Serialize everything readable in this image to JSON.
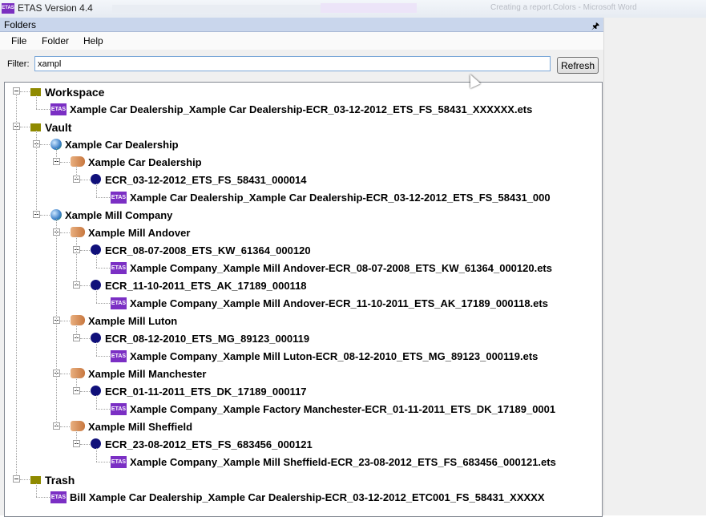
{
  "window": {
    "app_icon": "ETAS",
    "title": "ETAS Version 4.4",
    "background_text": "Creating a report.Colors - Microsoft Word"
  },
  "pane": {
    "title": "Folders",
    "pin_icon": "pin-icon"
  },
  "menu": [
    "File",
    "Folder",
    "Help"
  ],
  "filter": {
    "label": "Filter:",
    "value": "xampl",
    "refresh_label": "Refresh"
  },
  "tree": [
    {
      "level": 0,
      "icon": "folder",
      "label": "Workspace",
      "expandable": true
    },
    {
      "level": 1,
      "icon": "etas",
      "label": "Xample Car Dealership_Xample Car Dealership-ECR_03-12-2012_ETS_FS_58431_XXXXXX.ets",
      "expandable": false
    },
    {
      "level": 0,
      "icon": "folder",
      "label": "Vault",
      "expandable": true
    },
    {
      "level": 1,
      "icon": "globe",
      "label": "Xample Car Dealership",
      "expandable": true
    },
    {
      "level": 2,
      "icon": "hand",
      "label": "Xample Car Dealership",
      "expandable": true
    },
    {
      "level": 3,
      "icon": "dot",
      "label": "ECR_03-12-2012_ETS_FS_58431_000014",
      "expandable": true
    },
    {
      "level": 4,
      "icon": "etas",
      "label": "Xample Car Dealership_Xample Car Dealership-ECR_03-12-2012_ETS_FS_58431_000",
      "expandable": false
    },
    {
      "level": 1,
      "icon": "globe",
      "label": "Xample Mill Company",
      "expandable": true
    },
    {
      "level": 2,
      "icon": "hand",
      "label": "Xample Mill Andover",
      "expandable": true
    },
    {
      "level": 3,
      "icon": "dot",
      "label": "ECR_08-07-2008_ETS_KW_61364_000120",
      "expandable": true
    },
    {
      "level": 4,
      "icon": "etas",
      "label": "Xample Company_Xample Mill Andover-ECR_08-07-2008_ETS_KW_61364_000120.ets",
      "expandable": false
    },
    {
      "level": 3,
      "icon": "dot",
      "label": "ECR_11-10-2011_ETS_AK_17189_000118",
      "expandable": true
    },
    {
      "level": 4,
      "icon": "etas",
      "label": "Xample Company_Xample Mill Andover-ECR_11-10-2011_ETS_AK_17189_000118.ets",
      "expandable": false
    },
    {
      "level": 2,
      "icon": "hand",
      "label": "Xample Mill Luton",
      "expandable": true
    },
    {
      "level": 3,
      "icon": "dot",
      "label": "ECR_08-12-2010_ETS_MG_89123_000119",
      "expandable": true
    },
    {
      "level": 4,
      "icon": "etas",
      "label": "Xample Company_Xample Mill Luton-ECR_08-12-2010_ETS_MG_89123_000119.ets",
      "expandable": false
    },
    {
      "level": 2,
      "icon": "hand",
      "label": "Xample Mill Manchester",
      "expandable": true
    },
    {
      "level": 3,
      "icon": "dot",
      "label": "ECR_01-11-2011_ETS_DK_17189_000117",
      "expandable": true
    },
    {
      "level": 4,
      "icon": "etas",
      "label": "Xample Company_Xample Factory Manchester-ECR_01-11-2011_ETS_DK_17189_0001",
      "expandable": false
    },
    {
      "level": 2,
      "icon": "hand",
      "label": "Xample Mill Sheffield",
      "expandable": true
    },
    {
      "level": 3,
      "icon": "dot",
      "label": "ECR_23-08-2012_ETS_FS_683456_000121",
      "expandable": true
    },
    {
      "level": 4,
      "icon": "etas",
      "label": "Xample Company_Xample Mill Sheffield-ECR_23-08-2012_ETS_FS_683456_000121.ets",
      "expandable": false
    },
    {
      "level": 0,
      "icon": "folder",
      "label": "Trash",
      "expandable": true
    },
    {
      "level": 1,
      "icon": "etas",
      "label": "Bill Xample Car Dealership_Xample Car Dealership-ECR_03-12-2012_ETC001_FS_58431_XXXXX",
      "expandable": false
    }
  ],
  "icons": {
    "folder": "folder-icon",
    "etas": "etas-file-icon",
    "globe": "globe-icon",
    "hand": "handshake-icon",
    "dot": "record-dot-icon"
  },
  "colors": {
    "etas_purple": "#7b2fc4",
    "folder_olive": "#8f8a00",
    "record_navy": "#10107a",
    "pane_header": "#c9d6ec"
  }
}
